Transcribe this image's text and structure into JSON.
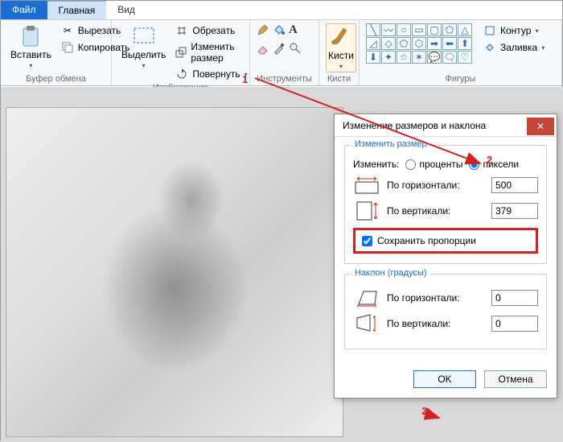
{
  "tabs": {
    "file": "Файл",
    "home": "Главная",
    "view": "Вид"
  },
  "clipboard": {
    "group": "Буфер обмена",
    "paste": "Вставить",
    "cut": "Вырезать",
    "copy": "Копировать"
  },
  "image": {
    "group": "Изображение",
    "select": "Выделить",
    "crop": "Обрезать",
    "resize": "Изменить размер",
    "rotate": "Повернуть"
  },
  "tools": {
    "group": "Инструменты"
  },
  "brushes": {
    "group": "Кисти",
    "label": "Кисти"
  },
  "shapes": {
    "group": "Фигуры",
    "contour": "Контур",
    "fill": "Заливка"
  },
  "dialog": {
    "title": "Изменение размеров и наклона",
    "resize_legend": "Изменить размер",
    "change_by": "Изменить:",
    "percent": "проценты",
    "pixels": "пиксели",
    "horizontal": "По горизонтали:",
    "vertical": "По вертикали:",
    "h_value": "500",
    "v_value": "379",
    "keep_aspect": "Сохранить пропорции",
    "skew_legend": "Наклон (градусы)",
    "skew_h": "0",
    "skew_v": "0",
    "ok": "OK",
    "cancel": "Отмена"
  },
  "annotations": {
    "one": "1",
    "two": "2",
    "three": "3"
  }
}
